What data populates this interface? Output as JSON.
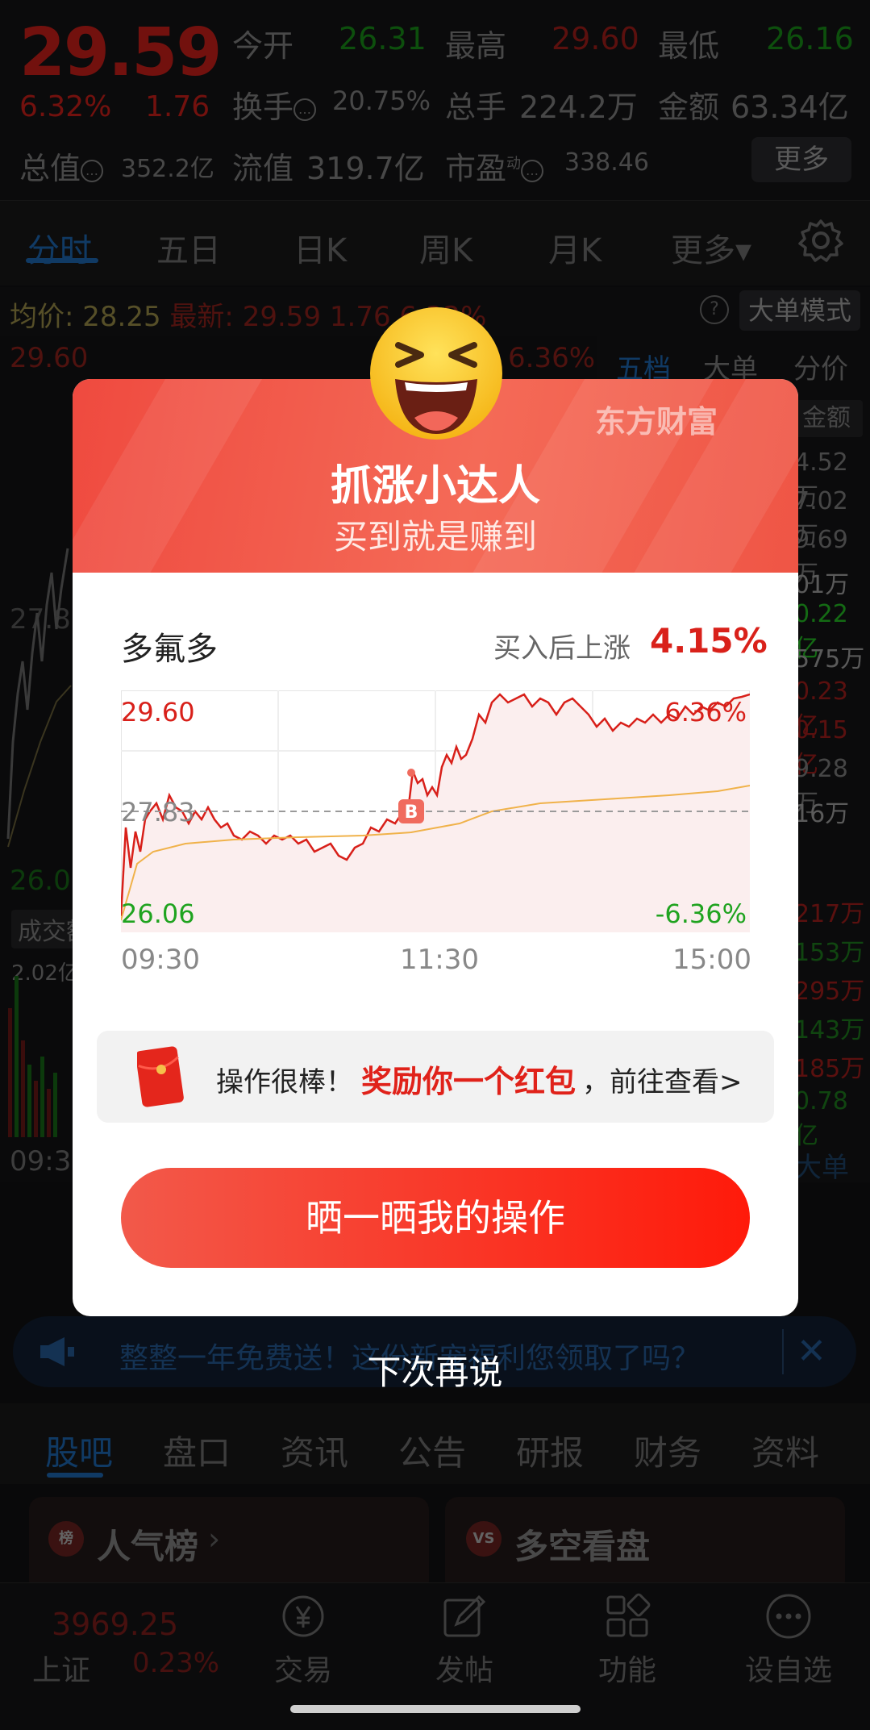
{
  "header": {
    "price": "29.59",
    "change_pct": "6.32%",
    "change_abs": "1.76",
    "open_label": "今开",
    "open_val": "26.31",
    "high_label": "最高",
    "high_val": "29.60",
    "low_label": "最低",
    "low_val": "26.16",
    "turnover_label": "换手",
    "turnover_val": "20.75%",
    "volume_label": "总手",
    "volume_val": "224.2万",
    "amount_label": "金额",
    "amount_val": "63.34亿",
    "mktcap_label": "总值",
    "mktcap_val": "352.2亿",
    "float_label": "流值",
    "float_val": "319.7亿",
    "pe_label": "市盈",
    "pe_sup": "动",
    "pe_val": "338.46",
    "more_label": "更多"
  },
  "chart_tabs": [
    "分时",
    "五日",
    "日K",
    "周K",
    "月K",
    "更多▾"
  ],
  "avg_bar": {
    "avg_label": "均价:",
    "avg_val": "28.25",
    "latest_label": "最新:",
    "latest_val": "29.59",
    "latest_chg": "1.76",
    "latest_pct": "6.32%",
    "help": "?",
    "mode_label": "大单模式"
  },
  "background_chart": {
    "top_price": "29.60",
    "mid_price": "27.83",
    "bottom_price": "26.0",
    "top_pct": "6.36%",
    "vol_label": "成交额",
    "vol_val": "2.02亿",
    "time_start": "09:3"
  },
  "side_panel": {
    "tabs": [
      "五档",
      "大单",
      "分价"
    ],
    "amount_header": "金额",
    "values": [
      {
        "v": "4.52万",
        "c": "#6c6c6c"
      },
      {
        "v": "7.02万",
        "c": "#6c6c6c"
      },
      {
        "v": "9.69万",
        "c": "#6c6c6c"
      },
      {
        "v": "01万",
        "c": "#8a8a8a"
      },
      {
        "v": "0.22亿",
        "c": "#1fa31f"
      },
      {
        "v": "575万",
        "c": "#8a8a8a"
      },
      {
        "v": "0.23亿",
        "c": "#8a1a17"
      },
      {
        "v": "0.15亿",
        "c": "#8a1a17"
      },
      {
        "v": "9.28万",
        "c": "#6c6c6c"
      },
      {
        "v": "16万",
        "c": "#8a8a8a"
      },
      {
        "v": "217万",
        "c": "#8a1a17"
      },
      {
        "v": "153万",
        "c": "#1a6a1a"
      },
      {
        "v": "295万",
        "c": "#8a1a17"
      },
      {
        "v": "143万",
        "c": "#1a6a1a"
      },
      {
        "v": "185万",
        "c": "#8a1a17"
      },
      {
        "v": "0.78亿",
        "c": "#1a6a1a"
      }
    ],
    "bottom_label": "大单"
  },
  "notice": {
    "text": "整整一年免费送！这份新宠福利您领取了吗？",
    "close": "✕"
  },
  "stock_tabs": [
    "股吧",
    "盘口",
    "资讯",
    "公告",
    "研报",
    "财务",
    "资料"
  ],
  "cards": [
    {
      "title": "人气榜",
      "badge": "榜",
      "chev": "›"
    },
    {
      "title": "多空看盘",
      "badge": "VS"
    }
  ],
  "index": {
    "value": "3969.25",
    "name": "上证",
    "pct": "0.23%"
  },
  "bottom_nav": [
    "交易",
    "发帖",
    "功能",
    "设自选"
  ],
  "modal": {
    "brand": "东方财富",
    "title": "抓涨小达人",
    "subtitle": "买到就是赚到",
    "stock_name": "多氟多",
    "gain_label": "买入后上涨",
    "gain_value": "4.15%",
    "chart": {
      "top_price": "29.60",
      "mid_price": "27.83",
      "bottom_price": "26.06",
      "top_pct": "6.36%",
      "bottom_pct": "-6.36%",
      "buy_marker": "B",
      "times": [
        "09:30",
        "11:30",
        "15:00"
      ]
    },
    "reward_text1": "操作很棒！",
    "reward_text2": "奖励你一个红包",
    "reward_text3": "，前往查看>",
    "share_button": "晒一晒我的操作"
  },
  "dismiss": "下次再说",
  "colors": {
    "up": "#e0261e",
    "down": "#1fa31f",
    "accent": "#1a5a9a",
    "modal_red": "#ef4a3f"
  }
}
